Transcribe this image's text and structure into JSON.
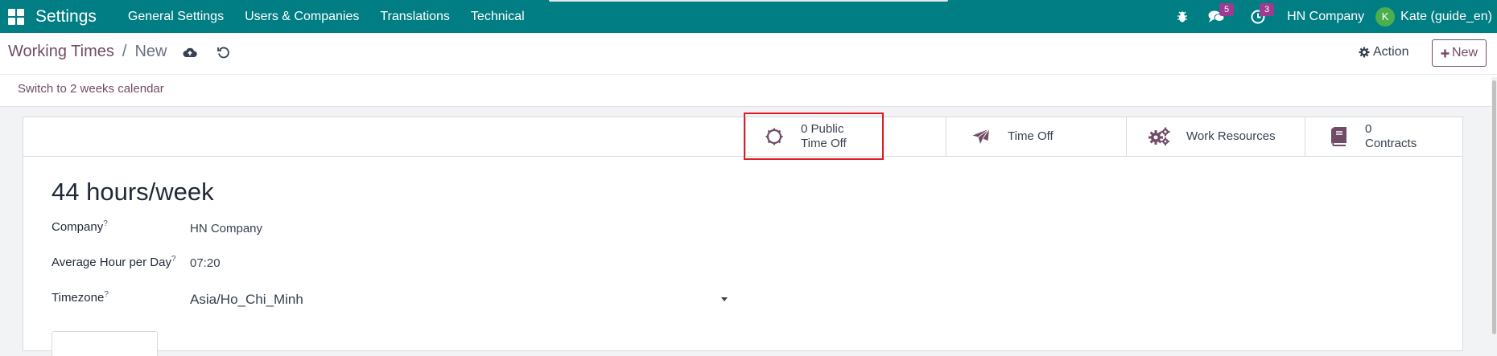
{
  "navbar": {
    "app_title": "Settings",
    "menu": [
      "General Settings",
      "Users & Companies",
      "Translations",
      "Technical"
    ],
    "messages_count": "5",
    "activities_count": "3",
    "company": "HN Company",
    "user_initial": "K",
    "user_name": "Kate (guide_en)",
    "icons": [
      "apps-grid-icon",
      "bug-icon",
      "chat-icon",
      "clock-icon"
    ]
  },
  "control": {
    "breadcrumb_parent": "Working Times",
    "breadcrumb_separator": "/",
    "breadcrumb_current": "New",
    "action_label": "Action",
    "new_label": "New",
    "switch_label": "Switch to 2 weeks calendar"
  },
  "smart_buttons": {
    "public_time_off_count": "0 Public",
    "public_time_off_label": "Time Off",
    "time_off_label": "Time Off",
    "work_resources_label": "Work Resources",
    "contracts_count": "0",
    "contracts_label": "Contracts"
  },
  "form": {
    "title": "44 hours/week",
    "company_label": "Company",
    "company_value": "HN Company",
    "avg_hours_label": "Average Hour per Day",
    "avg_hours_value": "07:20",
    "timezone_label": "Timezone",
    "timezone_value": "Asia/Ho_Chi_Minh",
    "help_marker": "?"
  },
  "colors": {
    "navbar": "#017e84",
    "brand": "#714b67",
    "badge": "#9c3b8f",
    "highlight": "#e01b24"
  }
}
